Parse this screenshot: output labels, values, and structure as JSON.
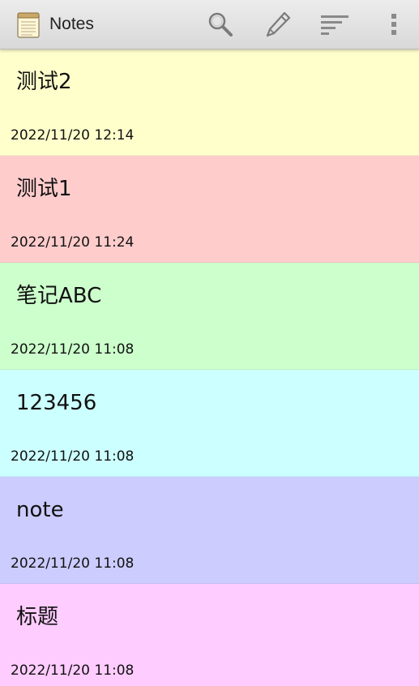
{
  "action_bar": {
    "title": "Notes",
    "icons": {
      "app": "notepad-icon",
      "search": "search-icon",
      "new_note": "pencil-icon",
      "sort": "sort-icon",
      "overflow": "overflow-menu-icon"
    }
  },
  "notes": [
    {
      "title": "测试2",
      "time": "2022/11/20 12:14",
      "color": "#ffffcc"
    },
    {
      "title": "测试1",
      "time": "2022/11/20 11:24",
      "color": "#ffcccc"
    },
    {
      "title": "笔记ABC",
      "time": "2022/11/20 11:08",
      "color": "#ccffcc"
    },
    {
      "title": "123456",
      "time": "2022/11/20 11:08",
      "color": "#ccffff"
    },
    {
      "title": "note",
      "time": "2022/11/20 11:08",
      "color": "#ccccff"
    },
    {
      "title": "标题",
      "time": "2022/11/20 11:08",
      "color": "#ffccff"
    }
  ]
}
